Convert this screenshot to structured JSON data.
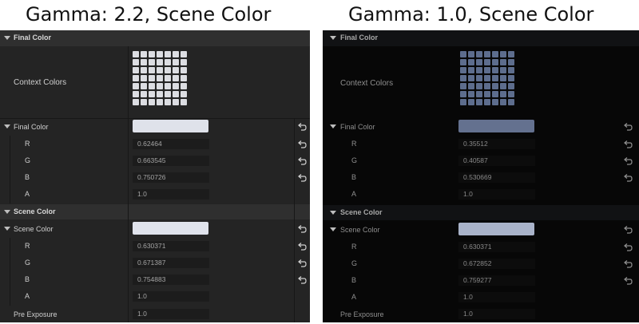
{
  "titles": {
    "left": "Gamma: 2.2, Scene Color",
    "right": "Gamma: 1.0, Scene Color"
  },
  "left_panel": {
    "final_section_label": "Final Color",
    "context_label": "Context Colors",
    "final_color_label": "Final Color",
    "final_channels": [
      {
        "name": "R",
        "value": "0.62464"
      },
      {
        "name": "G",
        "value": "0.663545"
      },
      {
        "name": "B",
        "value": "0.750726"
      },
      {
        "name": "A",
        "value": "1.0"
      }
    ],
    "scene_section_label": "Scene Color",
    "scene_color_label": "Scene Color",
    "scene_channels": [
      {
        "name": "R",
        "value": "0.630371"
      },
      {
        "name": "G",
        "value": "0.671387"
      },
      {
        "name": "B",
        "value": "0.754883"
      },
      {
        "name": "A",
        "value": "1.0"
      }
    ],
    "pre_exposure_label": "Pre Exposure",
    "pre_exposure_value": "1.0",
    "colors": {
      "context_cell": "#dcdde2",
      "final_swatch": "#dfe2ea",
      "scene_swatch": "#e0e3ec"
    }
  },
  "right_panel": {
    "final_section_label": "Final Color",
    "context_label": "Context Colors",
    "final_color_label": "Final Color",
    "final_channels": [
      {
        "name": "R",
        "value": "0.35512"
      },
      {
        "name": "G",
        "value": "0.40587"
      },
      {
        "name": "B",
        "value": "0.530669"
      },
      {
        "name": "A",
        "value": "1.0"
      }
    ],
    "scene_section_label": "Scene Color",
    "scene_color_label": "Scene Color",
    "scene_channels": [
      {
        "name": "R",
        "value": "0.630371"
      },
      {
        "name": "G",
        "value": "0.672852"
      },
      {
        "name": "B",
        "value": "0.759277"
      },
      {
        "name": "A",
        "value": "1.0"
      }
    ],
    "pre_exposure_label": "Pre Exposure",
    "pre_exposure_value": "1.0",
    "colors": {
      "context_cell": "#5d6d8d",
      "final_swatch": "#64718f",
      "scene_swatch": "#a9b3c9"
    }
  },
  "icons": {
    "collapse": "triangle-down-icon",
    "reset": "reset-arrow-icon"
  }
}
